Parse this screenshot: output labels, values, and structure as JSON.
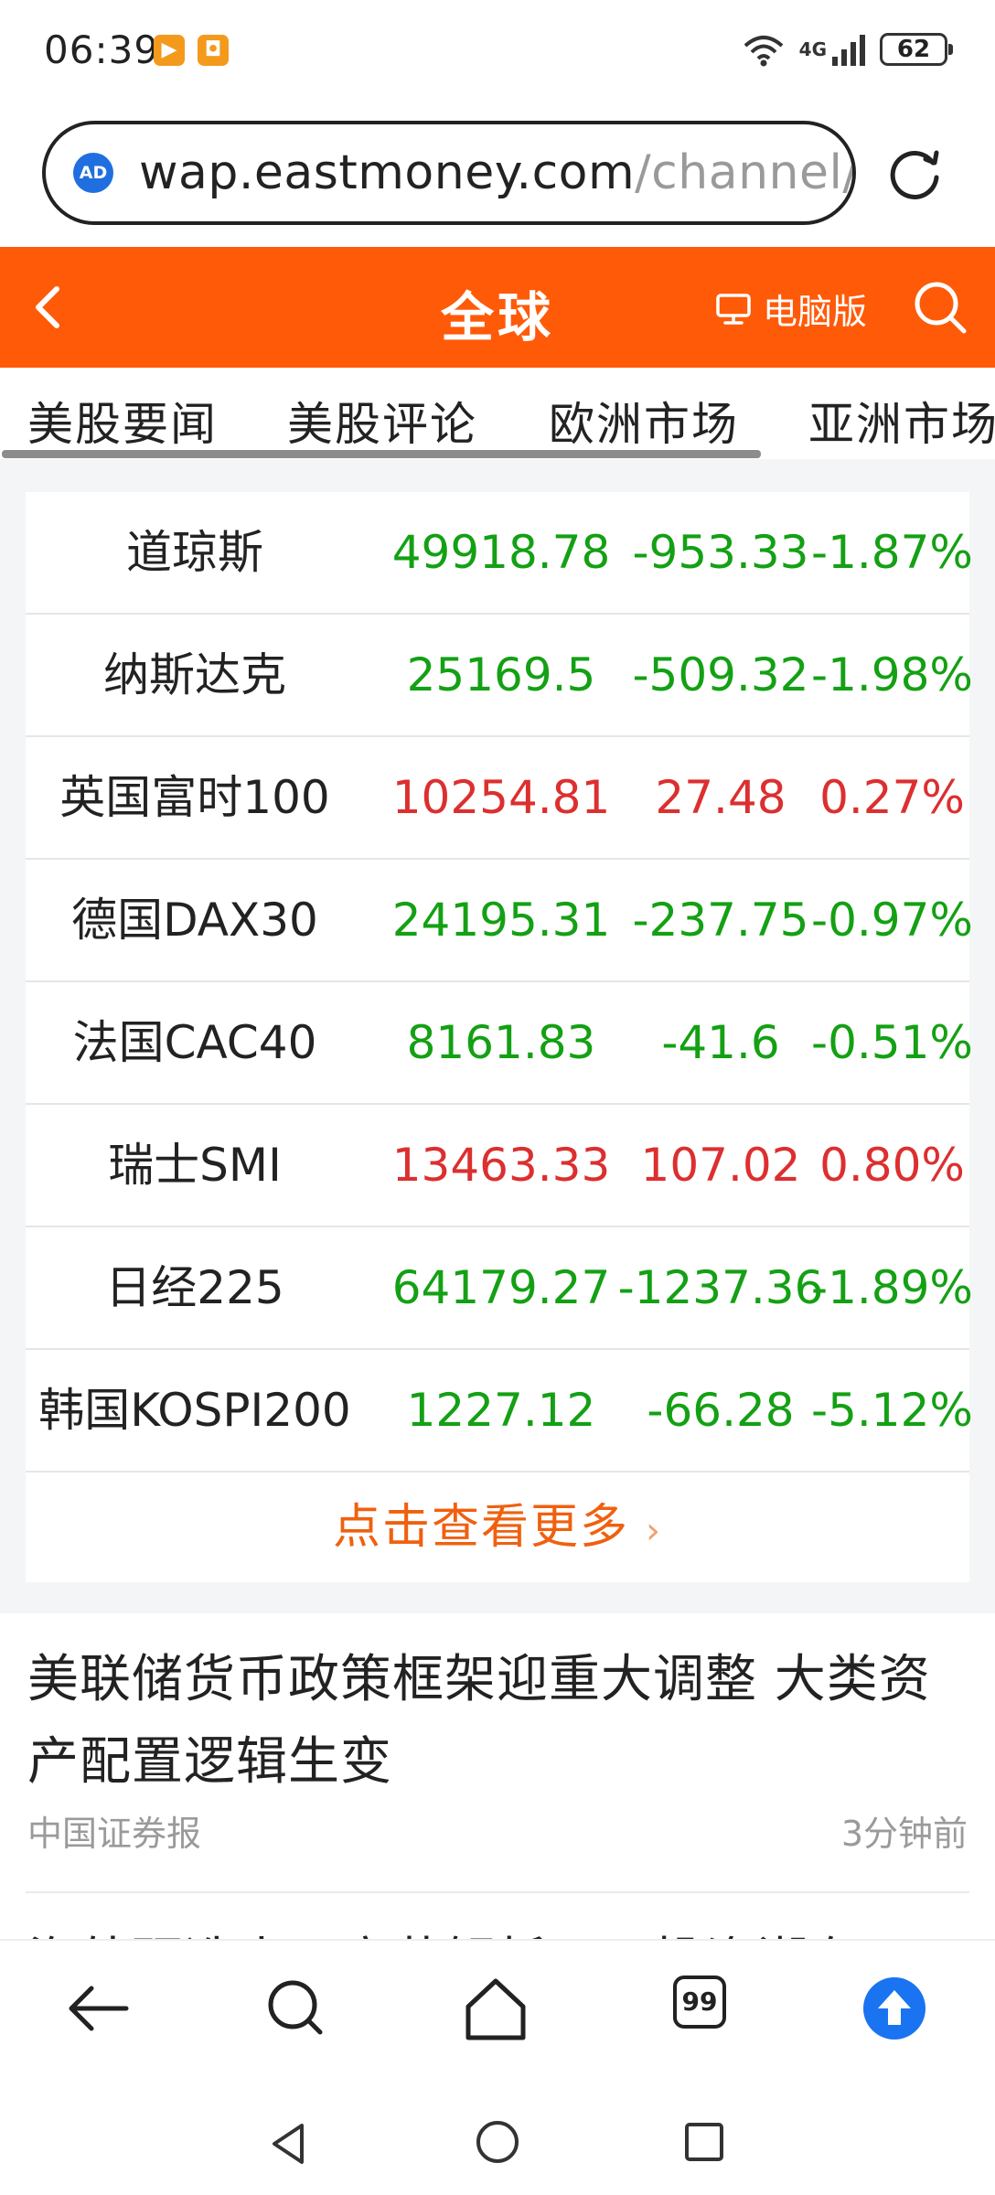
{
  "status_bar": {
    "time": "06:39",
    "network": "4G",
    "battery": "62"
  },
  "browser": {
    "url_domain": "wap.eastmoney.com",
    "url_path": "/channel/lis",
    "ad_badge": "AD",
    "tab_count": "99"
  },
  "header": {
    "title": "全球",
    "pc_version": "电脑版"
  },
  "tabs": [
    {
      "label": "美股要闻"
    },
    {
      "label": "美股评论"
    },
    {
      "label": "欧洲市场"
    },
    {
      "label": "亚洲市场"
    }
  ],
  "market": {
    "rows": [
      {
        "name": "道琼斯",
        "price": "49918.78",
        "change": "-953.33",
        "pct": "-1.87%",
        "direction": "down"
      },
      {
        "name": "纳斯达克",
        "price": "25169.5",
        "change": "-509.32",
        "pct": "-1.98%",
        "direction": "down"
      },
      {
        "name": "英国富时100",
        "price": "10254.81",
        "change": "27.48",
        "pct": "0.27%",
        "direction": "up"
      },
      {
        "name": "德国DAX30",
        "price": "24195.31",
        "change": "-237.75",
        "pct": "-0.97%",
        "direction": "down"
      },
      {
        "name": "法国CAC40",
        "price": "8161.83",
        "change": "-41.6",
        "pct": "-0.51%",
        "direction": "down"
      },
      {
        "name": "瑞士SMI",
        "price": "13463.33",
        "change": "107.02",
        "pct": "0.80%",
        "direction": "up"
      },
      {
        "name": "日经225",
        "price": "64179.27",
        "change": "-1237.36",
        "pct": "-1.89%",
        "direction": "down"
      },
      {
        "name": "韩国KOSPI200",
        "price": "1227.12",
        "change": "-66.28",
        "pct": "-5.12%",
        "direction": "down"
      }
    ],
    "more_label": "点击查看更多",
    "colors": {
      "down": "#14a014",
      "up": "#dc2f2f",
      "accent": "#ff5a08"
    }
  },
  "news": [
    {
      "title": "美联储货币政策框架迎重大调整 大类资产配置逻辑生变",
      "source": "中国证券报",
      "time": "3分钟前"
    },
    {
      "title": "海外研选丨工商薪解析，AI投资潮有无"
    }
  ]
}
